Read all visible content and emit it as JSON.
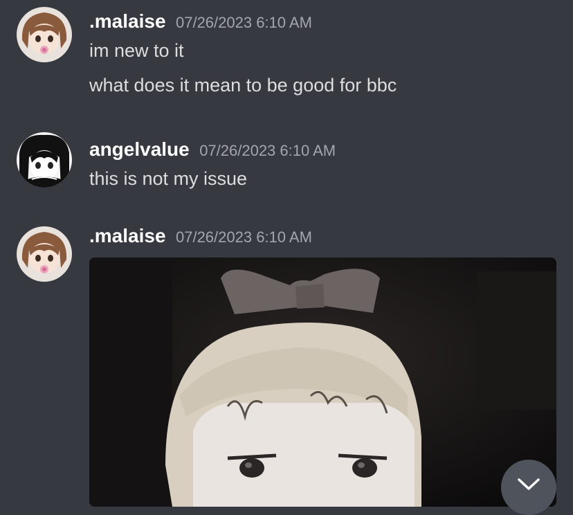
{
  "messages": [
    {
      "username": ".malaise",
      "timestamp": "07/26/2023 6:10 AM",
      "lines": [
        "im new to it",
        "what does it mean to be good for bbc"
      ]
    },
    {
      "username": "angelvalue",
      "timestamp": "07/26/2023 6:10 AM",
      "lines": [
        "this is not my issue"
      ]
    },
    {
      "username": ".malaise",
      "timestamp": "07/26/2023 6:10 AM",
      "attachment": "anime-character-image"
    }
  ],
  "scroll_button_icon": "chevron-down-icon",
  "colors": {
    "background": "#36393f",
    "username": "#ffffff",
    "timestamp": "#a3a6aa",
    "message_text": "#dcddde",
    "scroll_button": "#4f545c"
  }
}
